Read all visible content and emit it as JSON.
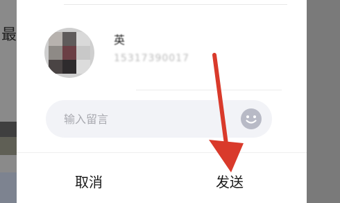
{
  "background": {
    "left_text": "最"
  },
  "contact": {
    "name": "英",
    "phone": "15317390017"
  },
  "message": {
    "placeholder": "输入留言",
    "value": ""
  },
  "actions": {
    "cancel_label": "取消",
    "send_label": "发送"
  },
  "colors": {
    "annotation_arrow": "#d93a2b",
    "input_background": "#f2f3f7",
    "emoji_icon": "#b8bac6"
  },
  "icons": {
    "emoji": "smiley-face-icon"
  }
}
